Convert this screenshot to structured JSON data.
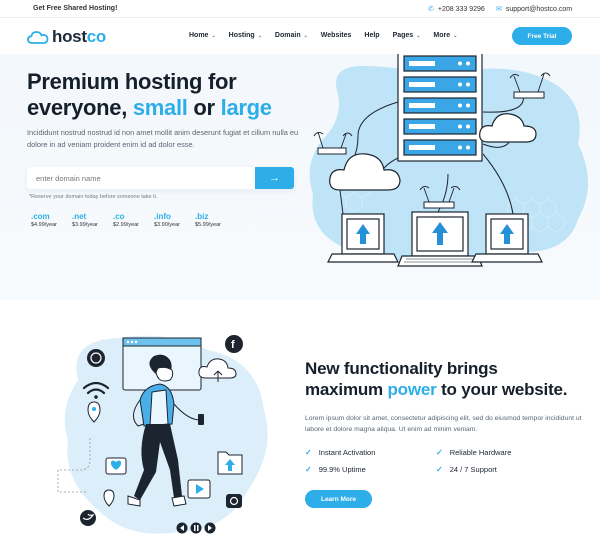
{
  "topbar": {
    "promo": "Get Free Shared Hosting!",
    "phone": "+208 333 9296",
    "email": "support@hostco.com",
    "phone_icon": "phone-icon",
    "email_icon": "envelope-icon"
  },
  "brand": {
    "logo_main": "host",
    "logo_accent": "co",
    "logo_icon": "cloud-icon",
    "accent_color": "#2eaee8",
    "dark_color": "#16202b"
  },
  "nav": {
    "items": [
      {
        "label": "Home",
        "dropdown": true
      },
      {
        "label": "Hosting",
        "dropdown": true
      },
      {
        "label": "Domain",
        "dropdown": true
      },
      {
        "label": "Websites",
        "dropdown": false
      },
      {
        "label": "Help",
        "dropdown": false
      },
      {
        "label": "Pages",
        "dropdown": true
      },
      {
        "label": "More",
        "dropdown": true
      }
    ],
    "cta": "Free Trial"
  },
  "hero": {
    "title_line1": "Premium hosting for",
    "title_word1": "everyone,",
    "title_hl1": "small",
    "title_word2": "or",
    "title_hl2": "large",
    "description": "Incididunt nostrud nostrud id non amet mollit anim deserunt fugiat et cillum nulla eu dolore in ad veniam proident enim id ad dolor esse.",
    "search_placeholder": "enter domain name",
    "search_button_icon": "arrow-right-icon",
    "reserve_note": "*Reserve your domain today before someone take it.",
    "tlds": [
      {
        "ext": ".com",
        "price": "$4.99/year"
      },
      {
        "ext": ".net",
        "price": "$3.99/year"
      },
      {
        "ext": ".co",
        "price": "$2.99/year"
      },
      {
        "ext": ".info",
        "price": "$3.90/year"
      },
      {
        "ext": ".biz",
        "price": "$5.99/year"
      }
    ]
  },
  "section2": {
    "title_line1": "New functionality brings",
    "title_pre": "maximum",
    "title_hl": "power",
    "title_post": "to your website.",
    "description": "Lorem ipsum dolor sit amet, consectetur adipiscing elit, sed do eiusmod tempor incididunt ut labore et dolore magna aliqua. Ut enim ad minim veniam.",
    "features": [
      "Instant Activation",
      "Reliable Hardware",
      "99.9% Uptime",
      "24 / 7 Support"
    ],
    "check_icon": "check-icon",
    "cta": "Learn More"
  }
}
